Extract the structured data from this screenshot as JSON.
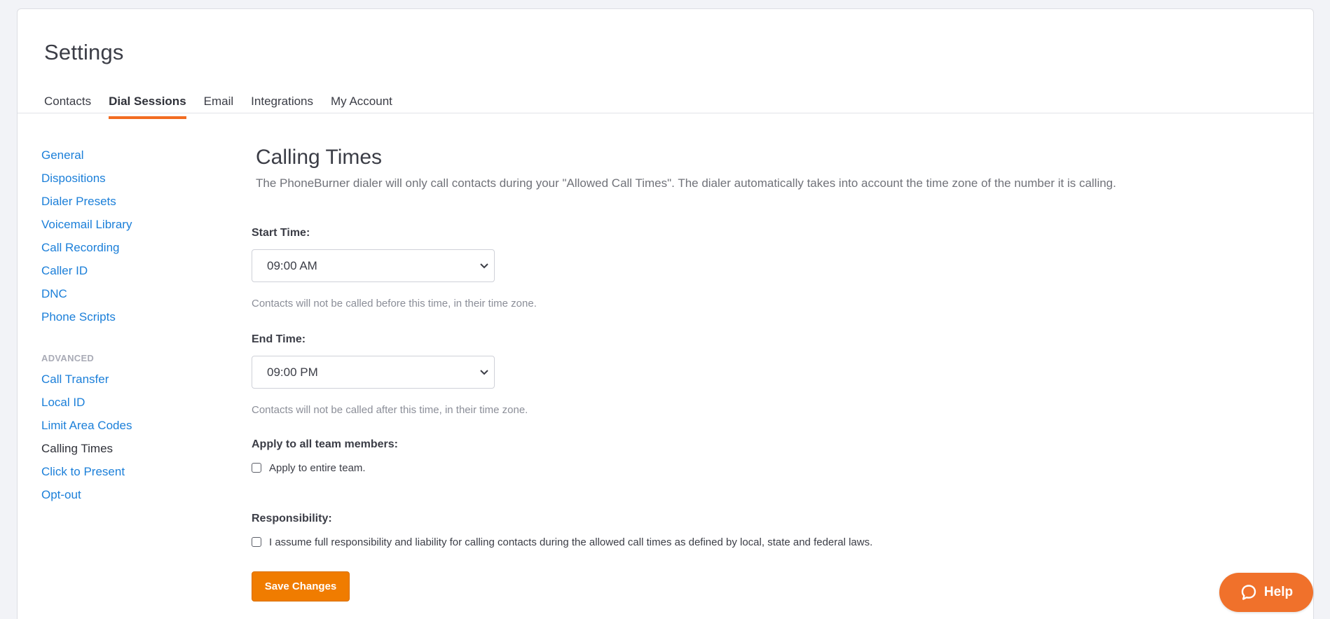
{
  "page": {
    "title": "Settings"
  },
  "tabs": [
    {
      "label": "Contacts",
      "active": false
    },
    {
      "label": "Dial Sessions",
      "active": true
    },
    {
      "label": "Email",
      "active": false
    },
    {
      "label": "Integrations",
      "active": false
    },
    {
      "label": "My Account",
      "active": false
    }
  ],
  "sidebar": {
    "items": [
      {
        "label": "General"
      },
      {
        "label": "Dispositions"
      },
      {
        "label": "Dialer Presets"
      },
      {
        "label": "Voicemail Library"
      },
      {
        "label": "Call Recording"
      },
      {
        "label": "Caller ID"
      },
      {
        "label": "DNC"
      },
      {
        "label": "Phone Scripts"
      }
    ],
    "advanced_heading": "ADVANCED",
    "advanced_items": [
      {
        "label": "Call Transfer"
      },
      {
        "label": "Local ID"
      },
      {
        "label": "Limit Area Codes"
      },
      {
        "label": "Calling Times",
        "current": true
      },
      {
        "label": "Click to Present"
      },
      {
        "label": "Opt-out"
      }
    ]
  },
  "content": {
    "title": "Calling Times",
    "description": "The PhoneBurner dialer will only call contacts during your \"Allowed Call Times\". The dialer automatically takes into account the time zone of the number it is calling.",
    "start_time": {
      "label": "Start Time:",
      "value": "09:00 AM",
      "help": "Contacts will not be called before this time, in their time zone."
    },
    "end_time": {
      "label": "End Time:",
      "value": "09:00 PM",
      "help": "Contacts will not be called after this time, in their time zone."
    },
    "team": {
      "label": "Apply to all team members:",
      "checkbox_label": "Apply to entire team.",
      "checked": false
    },
    "responsibility": {
      "label": "Responsibility:",
      "checkbox_label": "I assume full responsibility and liability for calling contacts during the allowed call times as defined by local, state and federal laws.",
      "checked": false
    },
    "save_label": "Save Changes"
  },
  "help_button": {
    "label": "Help",
    "icon": "chat-bubble-icon"
  },
  "colors": {
    "accent": "#f26c21",
    "link": "#1b7fd9",
    "save_button": "#f07c00",
    "help_button": "#f0712b",
    "background": "#f2f3f7"
  }
}
